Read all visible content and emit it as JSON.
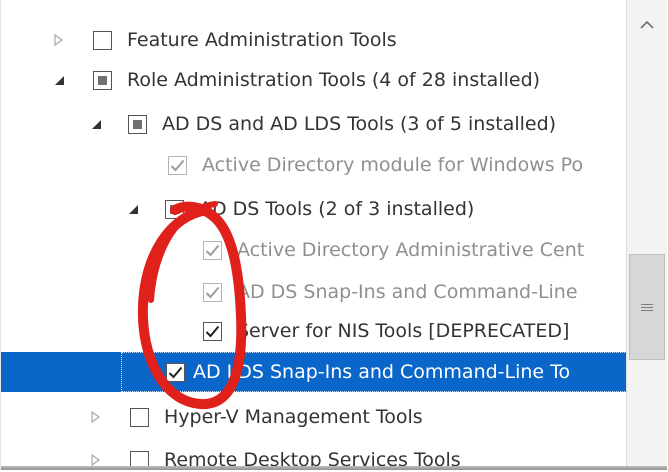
{
  "tree": {
    "items": [
      {
        "label": "Feature Administration Tools"
      },
      {
        "label": "Role Administration Tools (4 of 28 installed)"
      },
      {
        "label": "AD DS and AD LDS Tools (3 of 5 installed)"
      },
      {
        "label": "Active Directory module for Windows Po"
      },
      {
        "label": "AD DS Tools (2 of 3 installed)"
      },
      {
        "label": "Active Directory Administrative Cent"
      },
      {
        "label": "AD DS Snap-Ins and Command-Line"
      },
      {
        "label": "Server for NIS Tools [DEPRECATED]"
      },
      {
        "label": "AD LDS Snap-Ins and Command-Line To"
      },
      {
        "label": "Hyper-V Management Tools"
      },
      {
        "label": "Remote Desktop Services Tools"
      }
    ]
  },
  "colors": {
    "selection": "#0a66c8",
    "annotation": "#e0201b",
    "greyed_text": "#8f8f8f"
  },
  "icons": {
    "expanded": "filled-triangle-expanded-icon",
    "collapsed": "hollow-triangle-collapsed-icon",
    "scroll_up": "chevron-up-icon",
    "scroll_grip": "scroll-grip-icon"
  }
}
